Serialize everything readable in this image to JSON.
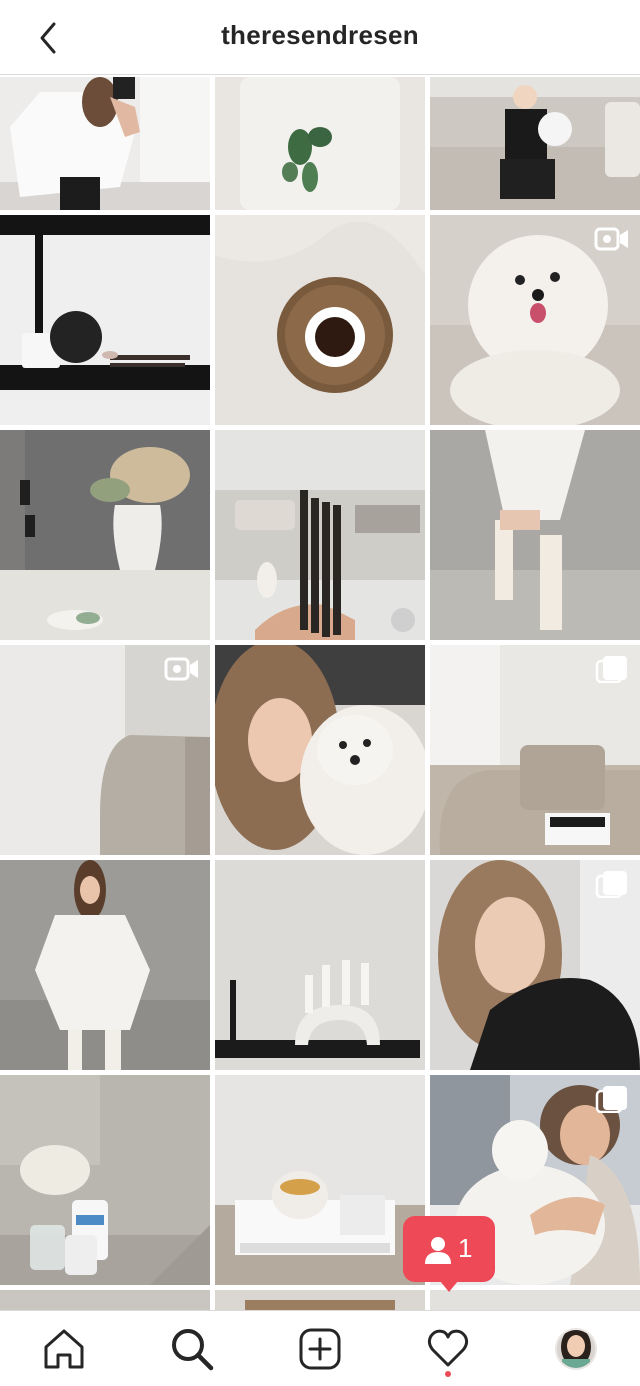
{
  "header": {
    "title": "theresendresen",
    "back_icon": "chevron-left-icon"
  },
  "grid": {
    "tiles": [
      {
        "subject": "woman in white top mirror selfie",
        "badge": ""
      },
      {
        "subject": "eucalyptus sprig on white pillow",
        "badge": ""
      },
      {
        "subject": "toddler on grey sofa with balloon",
        "badge": ""
      },
      {
        "subject": "black shelf with vase and brushes",
        "badge": ""
      },
      {
        "subject": "coffee cup on wooden plate on linen",
        "badge": ""
      },
      {
        "subject": "white fluffy dog licking",
        "badge": "video"
      },
      {
        "subject": "pampas grass vase on counter",
        "badge": ""
      },
      {
        "subject": "makeup brushes in living room",
        "badge": ""
      },
      {
        "subject": "woman in white dress and boots",
        "badge": ""
      },
      {
        "subject": "beige sofa corner",
        "badge": "video"
      },
      {
        "subject": "woman with white dog selfie",
        "badge": ""
      },
      {
        "subject": "sofa with cushion and box",
        "badge": "carousel"
      },
      {
        "subject": "woman in white knit dress against concrete",
        "badge": ""
      },
      {
        "subject": "candle holder on black shelf",
        "badge": ""
      },
      {
        "subject": "woman portrait in black sweater",
        "badge": "carousel"
      },
      {
        "subject": "flowers and cerave bottle in bathroom",
        "badge": ""
      },
      {
        "subject": "bowl and magazines on sofa",
        "badge": ""
      },
      {
        "subject": "man hugging white dog",
        "badge": "carousel"
      }
    ]
  },
  "notification": {
    "count": "1",
    "icon": "person-icon",
    "color": "#ed4956"
  },
  "nav": {
    "items": [
      {
        "name": "home",
        "icon": "home-icon"
      },
      {
        "name": "search",
        "icon": "search-icon"
      },
      {
        "name": "new-post",
        "icon": "plus-square-icon"
      },
      {
        "name": "activity",
        "icon": "heart-icon"
      },
      {
        "name": "profile",
        "icon": "avatar"
      }
    ]
  }
}
